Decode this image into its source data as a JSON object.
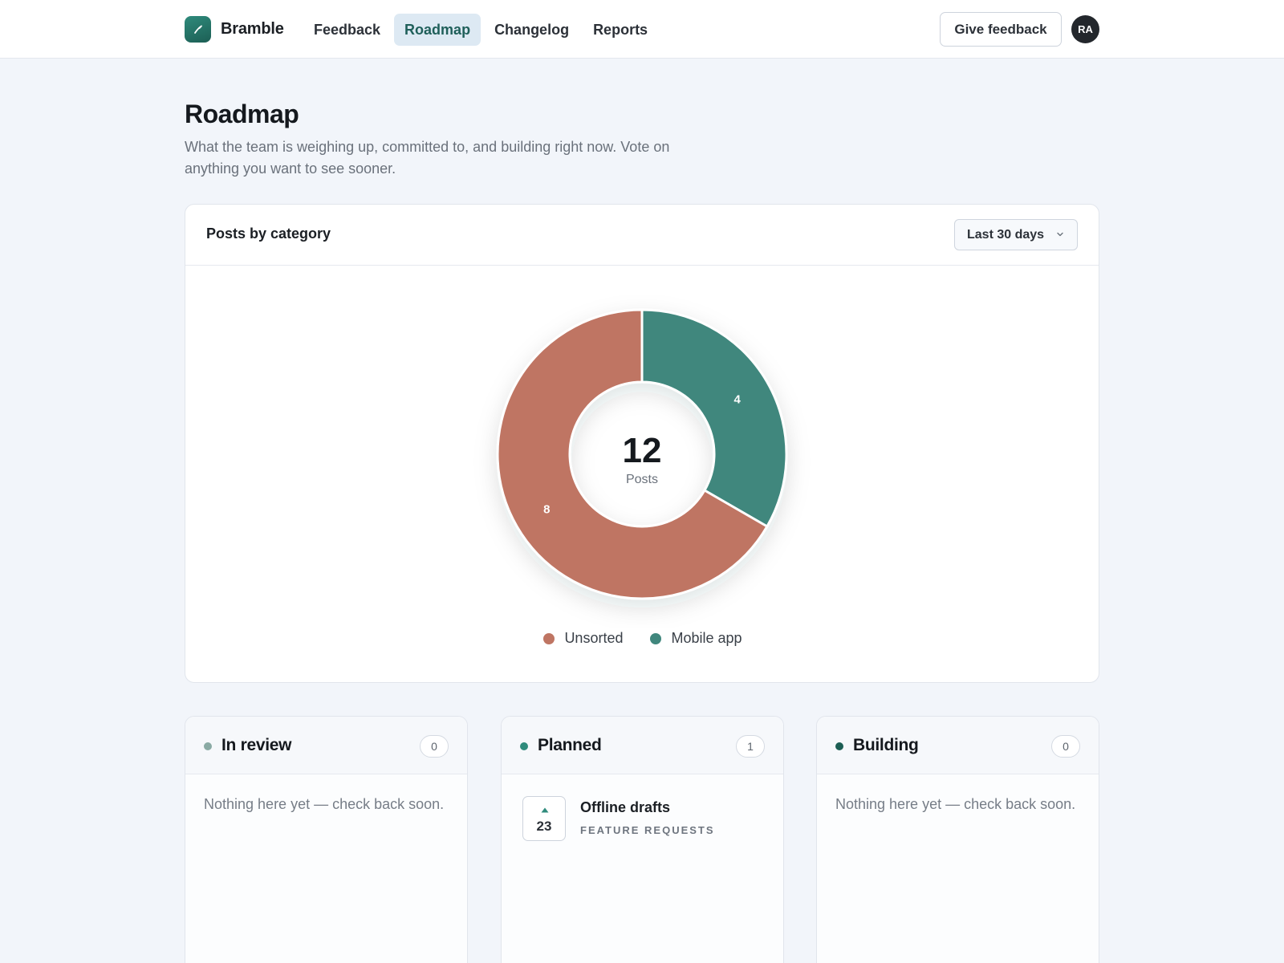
{
  "app": {
    "name": "Bramble"
  },
  "nav": {
    "items": [
      {
        "label": "Feedback"
      },
      {
        "label": "Roadmap",
        "active": true
      },
      {
        "label": "Changelog"
      },
      {
        "label": "Reports"
      }
    ],
    "give_feedback_label": "Give feedback",
    "avatar_initials": "RA"
  },
  "page": {
    "title": "Roadmap",
    "subtitle": "What the team is weighing up, committed to, and building right now. Vote on anything you want to see sooner."
  },
  "chart_card": {
    "title": "Posts by category",
    "range_label": "Last 30 days",
    "center_value": "12",
    "center_label": "Posts"
  },
  "chart_data": {
    "type": "pie",
    "title": "Posts by category",
    "categories": [
      "Unsorted",
      "Mobile app"
    ],
    "values": [
      8,
      4
    ],
    "colors": [
      "#bf7563",
      "#40877d"
    ],
    "legend_position": "bottom"
  },
  "columns": [
    {
      "title": "In review",
      "count": "0",
      "dot_color": "#8aaaa4",
      "empty_text": "Nothing here yet — check back soon."
    },
    {
      "title": "Planned",
      "count": "1",
      "dot_color": "#2f8b7c",
      "post": {
        "votes": "23",
        "title": "Offline drafts",
        "category": "FEATURE REQUESTS"
      }
    },
    {
      "title": "Building",
      "count": "0",
      "dot_color": "#1c5e54",
      "empty_text": "Nothing here yet — check back soon."
    }
  ]
}
